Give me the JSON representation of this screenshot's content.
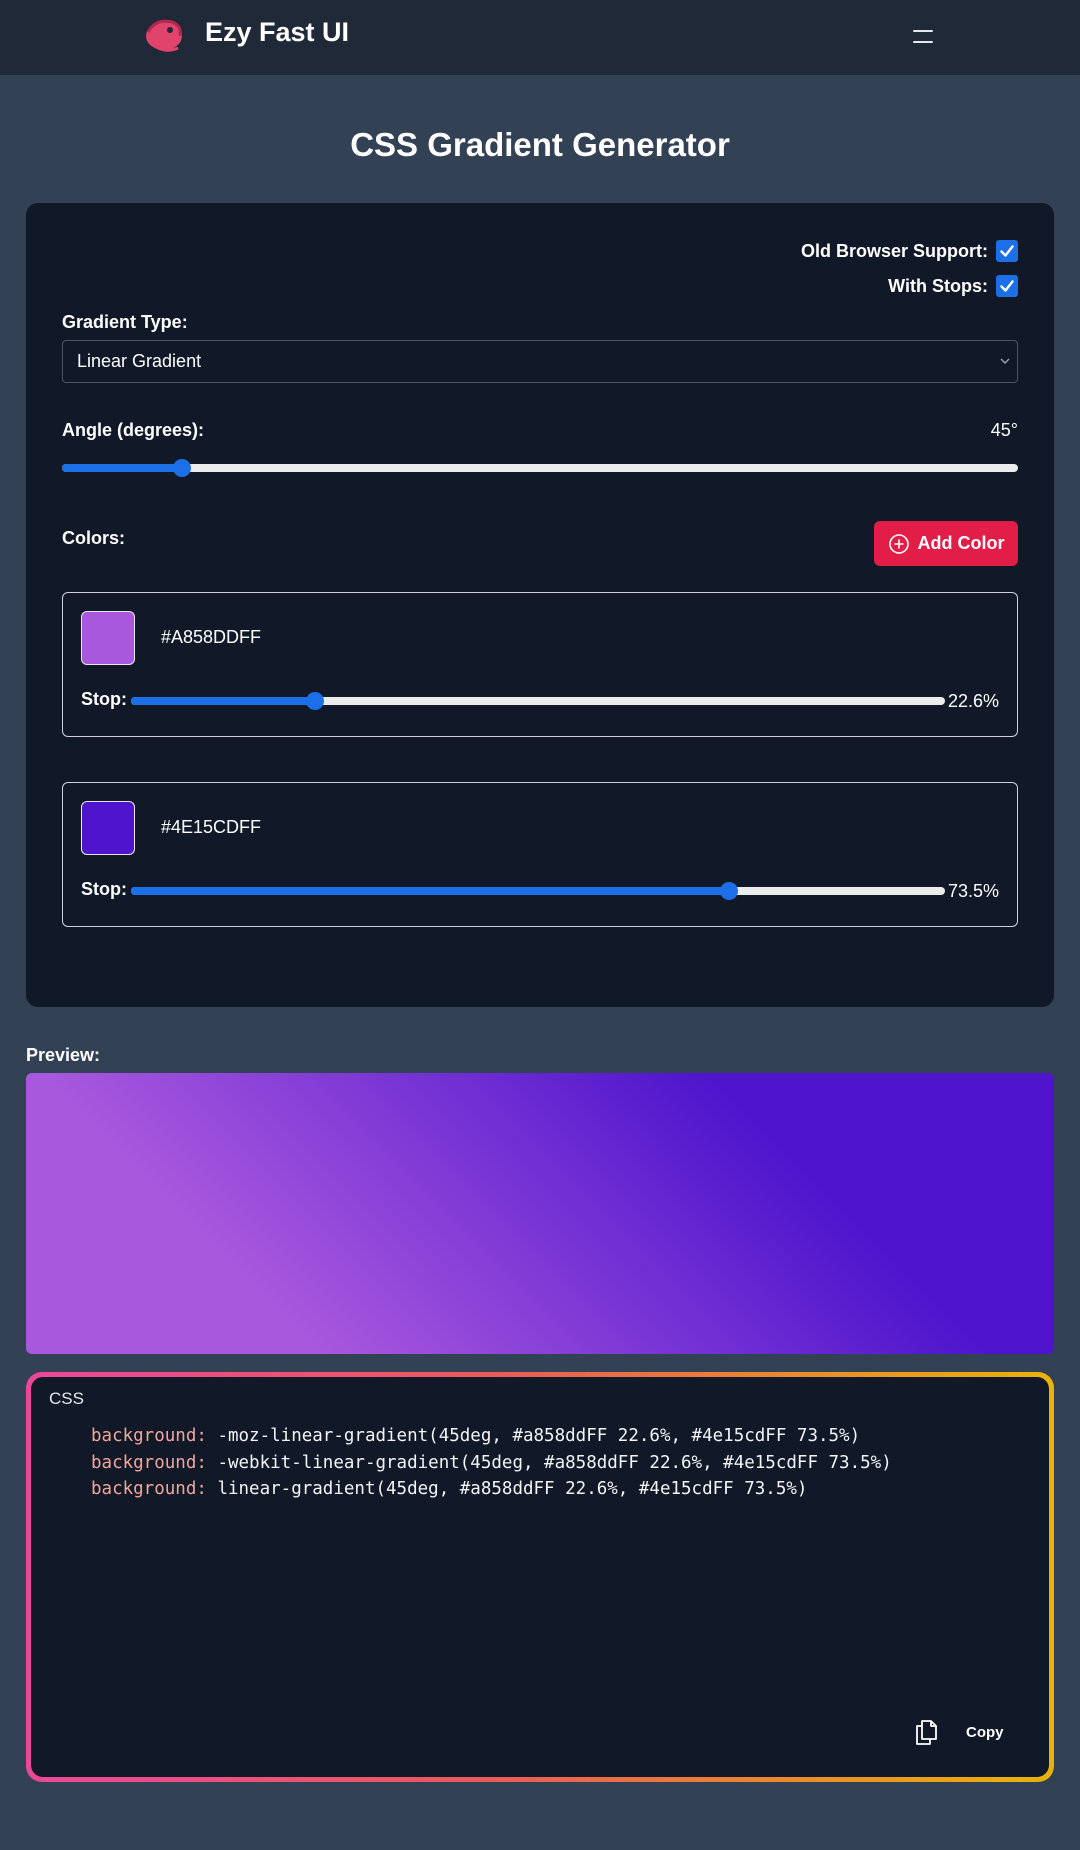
{
  "header": {
    "brand": "Ezy Fast UI"
  },
  "page": {
    "title": "CSS Gradient Generator"
  },
  "options": {
    "old_browser_label": "Old Browser Support:",
    "old_browser_checked": true,
    "with_stops_label": "With Stops:",
    "with_stops_checked": true
  },
  "gradient_type": {
    "label": "Gradient Type:",
    "selected": "Linear Gradient"
  },
  "angle": {
    "label": "Angle (degrees):",
    "display": "45°",
    "value": 45,
    "max": 360
  },
  "colors": {
    "label": "Colors:",
    "add_label": "Add Color",
    "items": [
      {
        "hex": "#A858DDFF",
        "swatch": "#a858dd",
        "stop_label": "Stop:",
        "stop_display": "22.6%",
        "stop": 22.6
      },
      {
        "hex": "#4E15CDFF",
        "swatch": "#4e15cd",
        "stop_label": "Stop:",
        "stop_display": "73.5%",
        "stop": 73.5
      }
    ]
  },
  "preview": {
    "label": "Preview:"
  },
  "css_output": {
    "title": "CSS",
    "lines": [
      {
        "prop": "background:",
        "value": " -moz-linear-gradient(45deg, #a858ddFF 22.6%, #4e15cdFF 73.5%)"
      },
      {
        "prop": "background:",
        "value": " -webkit-linear-gradient(45deg, #a858ddFF 22.6%, #4e15cdFF 73.5%)"
      },
      {
        "prop": "background:",
        "value": " linear-gradient(45deg, #a858ddFF 22.6%, #4e15cdFF 73.5%)"
      }
    ],
    "copy_label": "Copy"
  },
  "colors_theme": {
    "accent": "#1d6fe8",
    "danger": "#e11d48",
    "panel": "#111827",
    "page": "#334155"
  }
}
